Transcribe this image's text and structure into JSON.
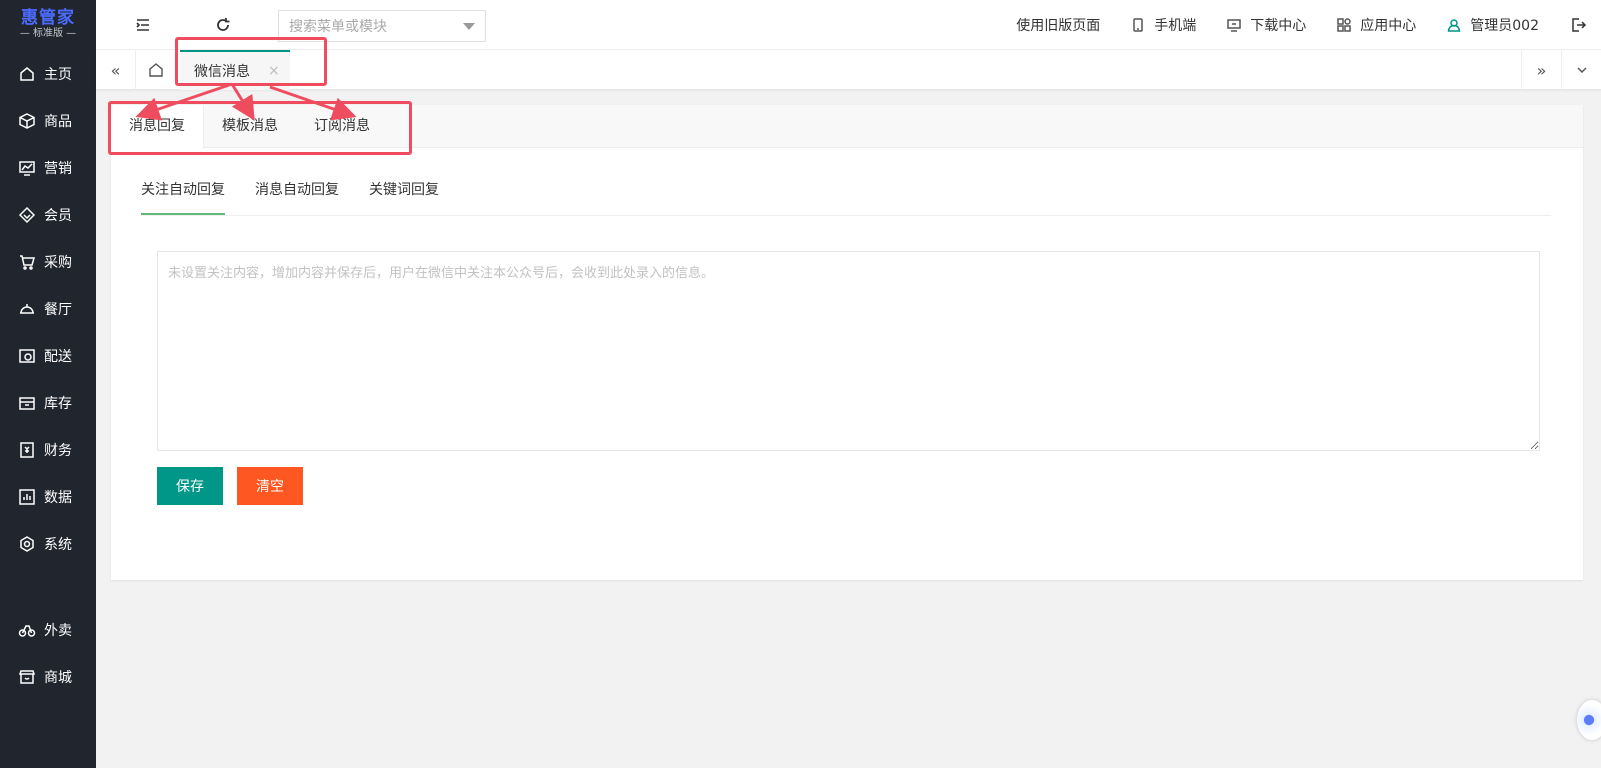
{
  "logo": {
    "name": "惠管家",
    "edition": "— 标准版 —"
  },
  "sidebar": {
    "items": [
      {
        "label": "主页",
        "icon": "home-icon"
      },
      {
        "label": "商品",
        "icon": "box-icon"
      },
      {
        "label": "营销",
        "icon": "chart-icon"
      },
      {
        "label": "会员",
        "icon": "diamond-icon"
      },
      {
        "label": "采购",
        "icon": "cart-icon"
      },
      {
        "label": "餐厅",
        "icon": "dish-icon"
      },
      {
        "label": "配送",
        "icon": "delivery-icon"
      },
      {
        "label": "库存",
        "icon": "inventory-icon"
      },
      {
        "label": "财务",
        "icon": "finance-icon"
      },
      {
        "label": "数据",
        "icon": "data-icon"
      },
      {
        "label": "系统",
        "icon": "settings-icon"
      },
      {
        "label": "外卖",
        "icon": "bike-icon"
      },
      {
        "label": "商城",
        "icon": "store-icon"
      }
    ]
  },
  "header": {
    "search_placeholder": "搜索菜单或模块",
    "links": [
      {
        "label": "使用旧版页面"
      },
      {
        "label": "手机端",
        "icon": "mobile-icon"
      },
      {
        "label": "下载中心",
        "icon": "monitor-icon"
      },
      {
        "label": "应用中心",
        "icon": "apps-icon"
      },
      {
        "label": "管理员002",
        "icon": "user-icon"
      }
    ]
  },
  "tabs": {
    "open_tab": {
      "label": "微信消息",
      "close": "×"
    },
    "left_arrow": "«",
    "right_arrow": "»"
  },
  "card": {
    "tabs": [
      {
        "label": "消息回复"
      },
      {
        "label": "模板消息"
      },
      {
        "label": "订阅消息"
      }
    ],
    "sub_tabs": [
      {
        "label": "关注自动回复"
      },
      {
        "label": "消息自动回复"
      },
      {
        "label": "关键词回复"
      }
    ],
    "textarea": {
      "value": "",
      "placeholder": "未设置关注内容，增加内容并保存后，用户在微信中关注本公众号后，会收到此处录入的信息。"
    },
    "save_label": "保存",
    "clear_label": "清空"
  },
  "colors": {
    "accent": "#009688",
    "danger": "#ff5722",
    "sidebar": "#21252e",
    "annotation": "#ef4d5f"
  }
}
